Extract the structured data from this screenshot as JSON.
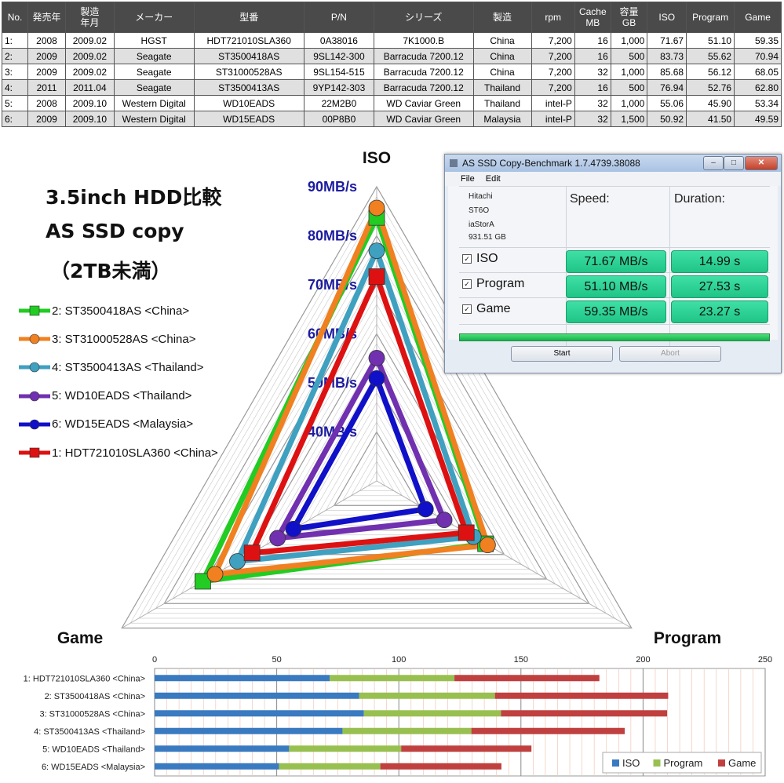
{
  "table": {
    "headers": [
      "No.",
      "発売年",
      "製造\n年月",
      "メーカー",
      "型番",
      "P/N",
      "シリーズ",
      "製造",
      "rpm",
      "Cache\nMB",
      "容量\nGB",
      "ISO",
      "Program",
      "Game"
    ],
    "rows": [
      [
        "1:",
        "2008",
        "2009.02",
        "HGST",
        "HDT721010SLA360",
        "0A38016",
        "7K1000.B",
        "China",
        "7,200",
        "16",
        "1,000",
        "71.67",
        "51.10",
        "59.35"
      ],
      [
        "2:",
        "2009",
        "2009.02",
        "Seagate",
        "ST3500418AS",
        "9SL142-300",
        "Barracuda 7200.12",
        "China",
        "7,200",
        "16",
        "500",
        "83.73",
        "55.62",
        "70.94"
      ],
      [
        "3:",
        "2009",
        "2009.02",
        "Seagate",
        "ST31000528AS",
        "9SL154-515",
        "Barracuda 7200.12",
        "China",
        "7,200",
        "32",
        "1,000",
        "85.68",
        "56.12",
        "68.05"
      ],
      [
        "4:",
        "2011",
        "2011.04",
        "Seagate",
        "ST3500413AS",
        "9YP142-303",
        "Barracuda 7200.12",
        "Thailand",
        "7,200",
        "16",
        "500",
        "76.94",
        "52.76",
        "62.80"
      ],
      [
        "5:",
        "2008",
        "2009.10",
        "Western Digital",
        "WD10EADS",
        "22M2B0",
        "WD Caviar Green",
        "Thailand",
        "intel-P",
        "32",
        "1,000",
        "55.06",
        "45.90",
        "53.34"
      ],
      [
        "6:",
        "2009",
        "2009.10",
        "Western Digital",
        "WD15EADS",
        "00P8B0",
        "WD Caviar Green",
        "Malaysia",
        "intel-P",
        "32",
        "1,500",
        "50.92",
        "41.50",
        "49.59"
      ]
    ]
  },
  "title_lines": [
    "3.5inch HDD比較",
    "AS SSD copy",
    "（2TB未満）"
  ],
  "chart_data": [
    {
      "type": "radar",
      "axes": [
        "ISO",
        "Program",
        "Game"
      ],
      "ring_labels": [
        "40MB/s",
        "50MB/s",
        "60MB/s",
        "70MB/s",
        "80MB/s",
        "90MB/s"
      ],
      "range": [
        30,
        90
      ],
      "series": [
        {
          "name": "2: ST3500418AS <China>",
          "color": "#22cc22",
          "marker": "square",
          "values": [
            83.73,
            55.62,
            70.94
          ]
        },
        {
          "name": "3: ST31000528AS <China>",
          "color": "#f08020",
          "marker": "circle",
          "values": [
            85.68,
            56.12,
            68.05
          ]
        },
        {
          "name": "4: ST3500413AS <Thailand>",
          "color": "#3fa0c0",
          "marker": "circle",
          "values": [
            76.94,
            52.76,
            62.8
          ]
        },
        {
          "name": "5: WD10EADS <Thailand>",
          "color": "#7030b0",
          "marker": "circle",
          "values": [
            55.06,
            45.9,
            53.34
          ]
        },
        {
          "name": "6: WD15EADS <Malaysia>",
          "color": "#1010c8",
          "marker": "circle",
          "values": [
            50.92,
            41.5,
            49.59
          ]
        },
        {
          "name": "1: HDT721010SLA360 <China>",
          "color": "#dd1111",
          "marker": "square",
          "values": [
            71.67,
            51.1,
            59.35
          ]
        }
      ]
    },
    {
      "type": "bar",
      "orientation": "horizontal",
      "stacked": true,
      "categories": [
        "1: HDT721010SLA360 <China>",
        "2: ST3500418AS <China>",
        "3: ST31000528AS <China>",
        "4: ST3500413AS <Thailand>",
        "5: WD10EADS <Thailand>",
        "6: WD15EADS <Malaysia>"
      ],
      "xlim": [
        0,
        250
      ],
      "xticks": [
        0,
        50,
        100,
        150,
        200,
        250
      ],
      "legend_position": "bottom-right",
      "series": [
        {
          "name": "ISO",
          "color": "#3a7ac0",
          "values": [
            71.67,
            83.73,
            85.68,
            76.94,
            55.06,
            50.92
          ]
        },
        {
          "name": "Program",
          "color": "#98c050",
          "values": [
            51.1,
            55.62,
            56.12,
            52.76,
            45.9,
            41.5
          ]
        },
        {
          "name": "Game",
          "color": "#c04040",
          "values": [
            59.35,
            70.94,
            68.05,
            62.8,
            53.34,
            49.59
          ]
        }
      ]
    }
  ],
  "ssd_window": {
    "title": "AS SSD Copy-Benchmark 1.7.4739.38088",
    "menu": [
      "File",
      "Edit"
    ],
    "drive_info": [
      "Hitachi",
      "ST6O",
      "iaStorA",
      "931.51 GB"
    ],
    "speed_header": "Speed:",
    "duration_header": "Duration:",
    "rows": [
      {
        "label": "ISO",
        "speed": "71.67 MB/s",
        "duration": "14.99 s"
      },
      {
        "label": "Program",
        "speed": "51.10 MB/s",
        "duration": "27.53 s"
      },
      {
        "label": "Game",
        "speed": "59.35 MB/s",
        "duration": "23.27 s"
      }
    ],
    "start_label": "Start",
    "abort_label": "Abort"
  }
}
